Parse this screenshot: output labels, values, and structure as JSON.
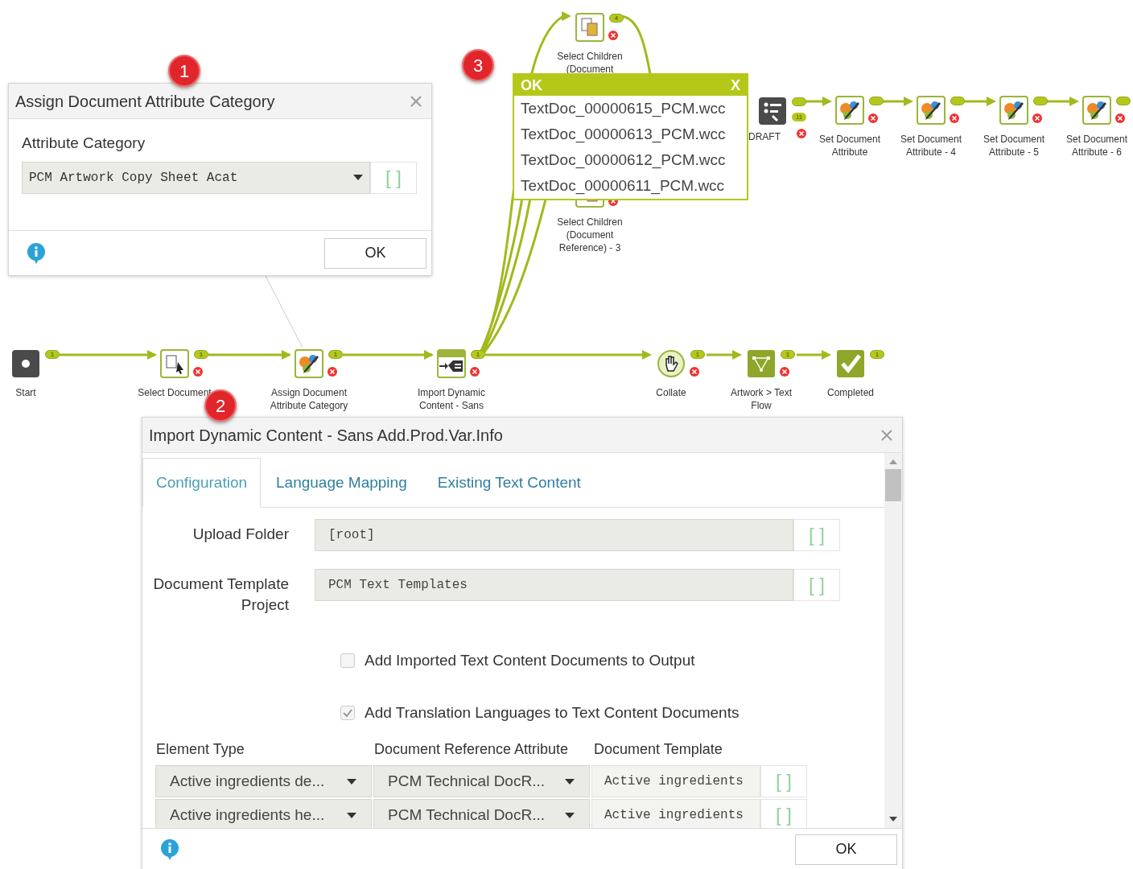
{
  "workflow": {
    "nodes": [
      {
        "label": [
          "Start"
        ],
        "kind": "start",
        "port": "1",
        "error": false
      },
      {
        "label": [
          "Select Document"
        ],
        "kind": "select",
        "port": "1",
        "error": true
      },
      {
        "label": [
          "Assign Document",
          "Attribute Category"
        ],
        "kind": "attribute",
        "port": "1",
        "error": true
      },
      {
        "label": [
          "Import Dynamic",
          "Content - Sans"
        ],
        "kind": "import",
        "port": "1",
        "error": true
      },
      {
        "label": [
          "Collate"
        ],
        "kind": "collate",
        "port": "1",
        "error": true
      },
      {
        "label": [
          "Artwork > Text",
          "Flow"
        ],
        "kind": "flow",
        "port": "1",
        "error": true
      },
      {
        "label": [
          "Completed"
        ],
        "kind": "completed",
        "port": "1",
        "error": false
      },
      {
        "label": [
          "Select Children",
          "(Document"
        ],
        "kind": "children",
        "port": "4",
        "error": true
      },
      {
        "label": [
          "Select Children",
          "(Document",
          "Reference) - 3"
        ],
        "kind": "children",
        "error": true
      },
      {
        "label": [
          "DRAFT"
        ],
        "kind": "draft",
        "count": "11",
        "error": true
      },
      {
        "label": [
          "Set Document",
          "Attribute"
        ],
        "kind": "attribute",
        "error": true
      },
      {
        "label": [
          "Set Document",
          "Attribute - 4"
        ],
        "kind": "attribute",
        "error": true
      },
      {
        "label": [
          "Set Document",
          "Attribute - 5"
        ],
        "kind": "attribute",
        "error": true
      },
      {
        "label": [
          "Set Document",
          "Attribute - 6"
        ],
        "kind": "attribute",
        "error": true
      }
    ]
  },
  "callouts": [
    "1",
    "2",
    "3"
  ],
  "attribute_dialog": {
    "title": "Assign Document Attribute Category",
    "field_label": "Attribute Category",
    "value": "PCM Artwork Copy Sheet Acat",
    "picker": "[ ]",
    "ok": "OK"
  },
  "result_popup": {
    "status": "OK",
    "close": "X",
    "items": [
      "TextDoc_00000615_PCM.wcc",
      "TextDoc_00000613_PCM.wcc",
      "TextDoc_00000612_PCM.wcc",
      "TextDoc_00000611_PCM.wcc"
    ]
  },
  "import_dialog": {
    "title": "Import Dynamic Content - Sans Add.Prod.Var.Info",
    "tabs": [
      {
        "label": "Configuration",
        "selected": true
      },
      {
        "label": "Language Mapping",
        "selected": false
      },
      {
        "label": "Existing Text Content",
        "selected": false
      }
    ],
    "fields": [
      {
        "label": "Upload Folder",
        "value": "[root]",
        "picker": "[ ]"
      },
      {
        "label": "Document Template Project",
        "value": "PCM Text Templates",
        "picker": "[ ]"
      }
    ],
    "options": [
      {
        "label": "Add Imported Text Content Documents to Output",
        "checked": false
      },
      {
        "label": "Add Translation Languages to Text Content Documents",
        "checked": true
      }
    ],
    "table": {
      "columns": [
        "Element Type",
        "Document Reference Attribute",
        "Document Template"
      ],
      "rows": [
        [
          "Active ingredients de...",
          "PCM Technical DocR...",
          "Active ingredients",
          "[ ]"
        ],
        [
          "Active ingredients he...",
          "PCM Technical DocR...",
          "Active ingredients",
          "[ ]"
        ]
      ]
    },
    "ok": "OK"
  }
}
